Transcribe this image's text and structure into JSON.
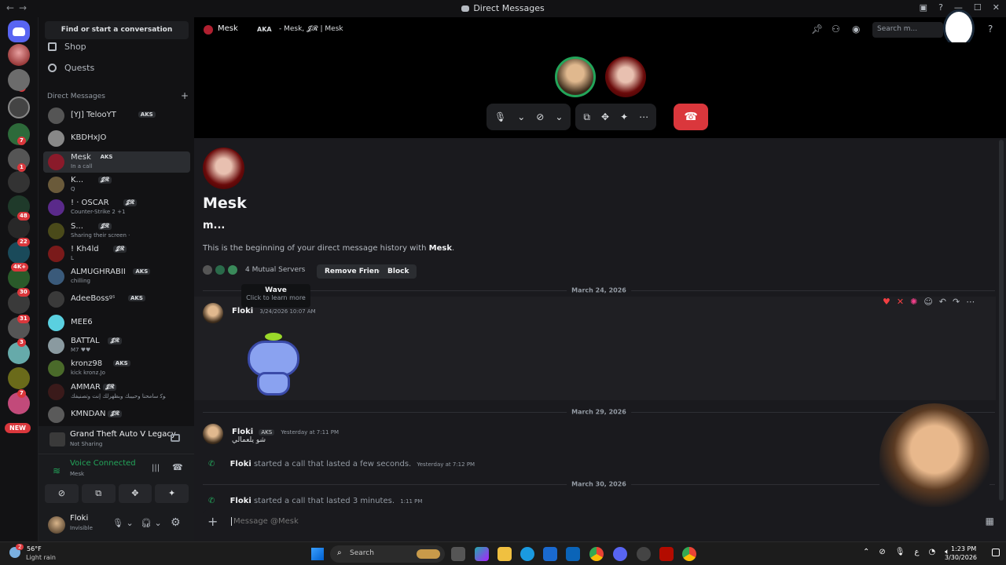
{
  "window": {
    "title": "Direct Messages"
  },
  "guilds": {
    "badges": [
      "2",
      "7",
      "1",
      "48",
      "22",
      "4K+",
      "30",
      "31",
      "3",
      "7"
    ],
    "new_label": "NEW"
  },
  "sidebar": {
    "search_label": "Find or start a conversation",
    "links": [
      {
        "label": "Shop",
        "icon": "shop-icon"
      },
      {
        "label": "Quests",
        "icon": "quests-icon"
      }
    ],
    "dm_header": "Direct Messages",
    "dms": [
      {
        "name": "[YJ] TelooYT",
        "tag": "AKS",
        "sub": ""
      },
      {
        "name": "KBDHxJO",
        "tag": "",
        "sub": ""
      },
      {
        "name": "Mesk",
        "tag": "AKS",
        "sub": "In a call"
      },
      {
        "name": "K...",
        "tag": "𝓙𝓡",
        "sub": "Q"
      },
      {
        "name": "! · OSCAR",
        "tag": "𝓙𝓡",
        "sub": "Counter-Strike 2 +1"
      },
      {
        "name": "S...",
        "tag": "𝓙𝓡",
        "sub": "Sharing their screen ·"
      },
      {
        "name": "! Kh4ld",
        "tag": "𝓙𝓡",
        "sub": "L"
      },
      {
        "name": "ALMUGHRABII",
        "tag": "AKS",
        "sub": "chilling"
      },
      {
        "name": "AdeeBossᵍˢ",
        "tag": "AKS",
        "sub": ""
      },
      {
        "name": "MEE6",
        "tag": "",
        "sub": ""
      },
      {
        "name": "BATTAL",
        "tag": "𝓙𝓡",
        "sub": "M7 ♥♥"
      },
      {
        "name": "kronz98",
        "tag": "AKS",
        "sub": "kick kronz.Jo"
      },
      {
        "name": "AMMAR",
        "tag": "𝓙𝓡",
        "sub": "ﻮﻛ ﺳﺎﻣﺤﻨﺎ ﻭﺣﺒﻴﺒﻚ ﻭﺑﻈﻬﺮﻟﻚ ﺇﻧﺖ ﻭﺗﺼﻨﻴﻔﻚ"
      },
      {
        "name": "KMNDAN",
        "tag": "𝓙𝓡",
        "sub": ""
      }
    ],
    "activity": {
      "title": "Grand Theft Auto V Legacy",
      "sub": "Not Sharing"
    },
    "voice": {
      "status": "Voice Connected",
      "channel": "Mesk"
    },
    "user": {
      "name": "Floki",
      "status": "Invisible"
    }
  },
  "topbar": {
    "name": "Mesk",
    "aka_label": "AKA",
    "aka_value": "- Mesk, 𝓙𝓡 | Mesk",
    "search_placeholder": "Search m..."
  },
  "profile": {
    "name": "Mesk",
    "username": "m...",
    "intro_prefix": "This is the beginning of your direct message history with ",
    "intro_name": "Mesk",
    "intro_suffix": ".",
    "mutual": "4 Mutual Servers",
    "remove_friend": "Remove Friend",
    "block": "Block"
  },
  "tooltip": {
    "title": "Wave",
    "sub": "Click to learn more"
  },
  "messages": {
    "date1": "March 24, 2026",
    "msg1_author": "Floki",
    "msg1_time": "3/24/2026 10:07 AM",
    "date2": "March 29, 2026",
    "msg2_author": "Floki",
    "msg2_tag": "AKS",
    "msg2_time": "Yesterday at 7:11 PM",
    "msg2_text": "شو يلعمالي",
    "call1_author": "Floki",
    "call1_text": " started a call that lasted a few seconds.",
    "call1_time": "Yesterday at 7:12 PM",
    "date3": "March 30, 2026",
    "call2_author": "Floki",
    "call2_text": " started a call that lasted 3 minutes.",
    "call2_time": "1:11 PM"
  },
  "composer": {
    "placeholder": "Message @Mesk"
  },
  "taskbar": {
    "temp": "56°F",
    "weather": "Light rain",
    "weather_badge": "2",
    "search": "Search",
    "time": "1:23 PM",
    "date": "3/30/2026",
    "lang": "ع"
  },
  "colors": {
    "accent": "#5865f2",
    "danger": "#da373c",
    "online": "#23a55a",
    "bg": "#1a1a1e",
    "sidebar": "#121214"
  }
}
